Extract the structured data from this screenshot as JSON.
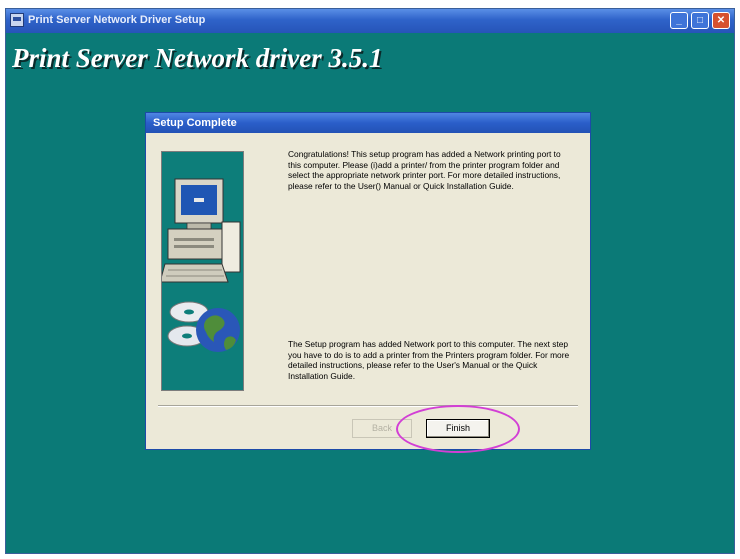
{
  "window": {
    "title": "Print Server Network Driver Setup",
    "heading": "Print Server Network driver 3.5.1",
    "controls": {
      "minimize": "_",
      "maximize": "□",
      "close": "✕"
    },
    "background_color": "#0b7a77"
  },
  "dialog": {
    "title": "Setup Complete",
    "message_1": "Congratulations! This setup program has added a Network printing port to this computer.  Please (i)add a printer/ from the printer program folder and select the appropriate network printer port.  For more detailed instructions, please refer to the User() Manual or Quick Installation Guide.",
    "message_2": "The Setup program has added Network port to this computer. The next step you have to do is to add a printer from the Printers program folder. For more detailed instructions, please refer to the User's Manual or the Quick Installation Guide.",
    "buttons": {
      "back": {
        "label": "Back",
        "enabled": false
      },
      "finish": {
        "label": "Finish",
        "enabled": true
      }
    },
    "illustration": [
      "computer-icon",
      "cd-disc-icon",
      "globe-icon"
    ]
  },
  "annotation": {
    "type": "circle",
    "target": "finish-button",
    "color": "#d23fd5"
  }
}
